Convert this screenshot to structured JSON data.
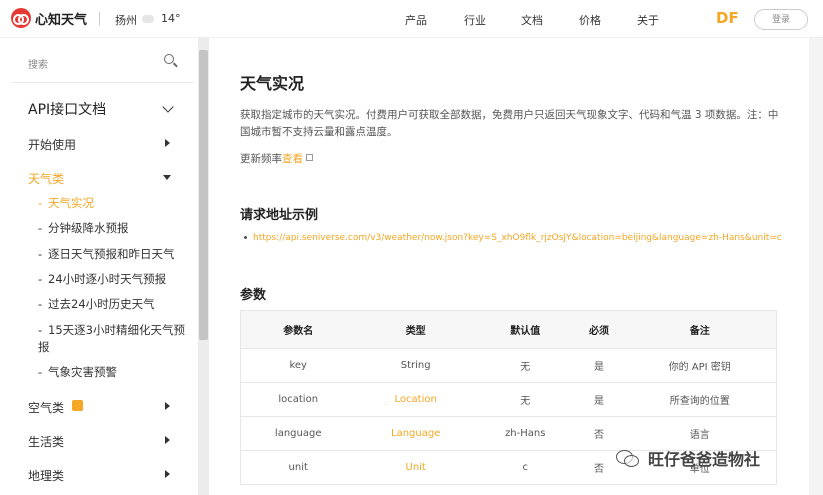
{
  "header": {
    "logo_text": "心知天气",
    "city": "扬州",
    "temperature": "14°",
    "nav": [
      "产品",
      "行业",
      "文档",
      "价格",
      "关于"
    ],
    "brand_mark": "DF",
    "login_label": "登录"
  },
  "sidebar": {
    "search_placeholder": "搜索",
    "doc_title": "API接口文档",
    "categories": {
      "start": "开始使用",
      "weather": "天气类",
      "air": "空气类",
      "life": "生活类",
      "geo": "地理类"
    },
    "weather_items": [
      "天气实况",
      "分钟级降水预报",
      "逐日天气预报和昨日天气",
      "24小时逐小时天气预报",
      "过去24小时历史天气",
      "15天逐3小时精细化天气预报",
      "气象灾害预警"
    ]
  },
  "main": {
    "title": "天气实况",
    "description": "获取指定城市的天气实况。付费用户可获取全部数据，免费用户只返回天气现象文字、代码和气温 3 项数据。注：中国城市暂不支持云量和露点温度。",
    "freq_prefix": "更新频率",
    "freq_link": "查看",
    "request_heading": "请求地址示例",
    "request_url": "https://api.seniverse.com/v3/weather/now.json?key=S_xhO9flk_rjzOsJY&location=beijing&language=zh-Hans&unit=c",
    "params_heading": "参数",
    "table": {
      "headers": [
        "参数名",
        "类型",
        "默认值",
        "必须",
        "备注"
      ],
      "rows": [
        [
          "key",
          "String",
          "无",
          "是",
          "你的 API 密钥"
        ],
        [
          "location",
          "Location",
          "无",
          "是",
          "所查询的位置"
        ],
        [
          "language",
          "Language",
          "zh-Hans",
          "否",
          "语言"
        ],
        [
          "unit",
          "Unit",
          "c",
          "否",
          "单位"
        ]
      ]
    }
  },
  "watermark": "旺仔爸爸造物社",
  "colors": {
    "accent": "#f5a623",
    "logo": "#e53935"
  }
}
